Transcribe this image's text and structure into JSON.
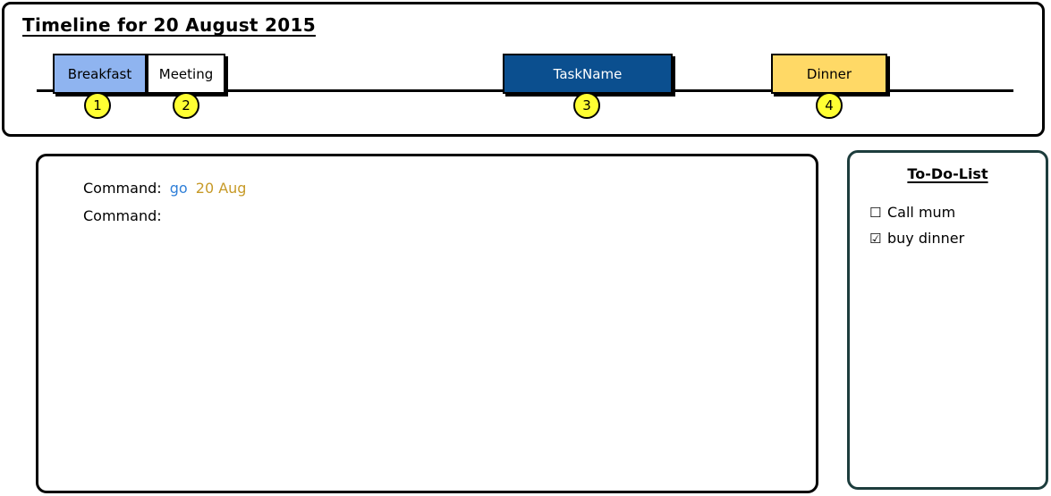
{
  "timeline": {
    "title": "Timeline for 20 August 2015",
    "events": [
      {
        "label": "Breakfast",
        "marker": "1",
        "bg": "#8fb4f0",
        "fg": "#000000"
      },
      {
        "label": "Meeting",
        "marker": null,
        "bg": "#ffffff",
        "fg": "#000000"
      },
      {
        "label": "TaskName",
        "marker": "3",
        "bg": "#0b4f8f",
        "fg": "#ffffff"
      },
      {
        "label": "Dinner",
        "marker": "4",
        "bg": "#ffd966",
        "fg": "#000000"
      }
    ],
    "markers": [
      "1",
      "2",
      "3",
      "4"
    ],
    "marker_color": "#ffff33"
  },
  "console": {
    "lines": [
      {
        "prompt": "Command:",
        "verb": "go",
        "arg": "20 Aug"
      },
      {
        "prompt": "Command:",
        "verb": "",
        "arg": ""
      }
    ],
    "verb_color": "#2f7fd8",
    "arg_color": "#c79a28"
  },
  "todo": {
    "title": "To-Do-List",
    "items": [
      {
        "label": "Call mum",
        "checked": false,
        "box": "☐"
      },
      {
        "label": "buy dinner",
        "checked": true,
        "box": "☑"
      }
    ]
  }
}
